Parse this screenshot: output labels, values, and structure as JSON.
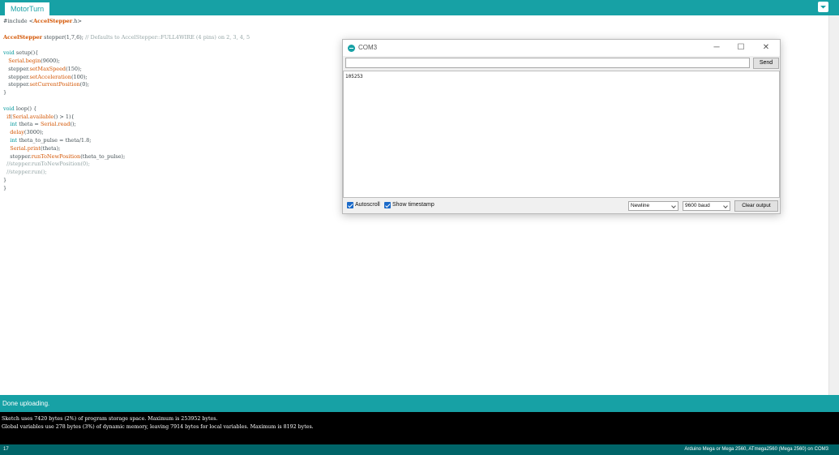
{
  "tabbar": {
    "active_tab": "MotorTurn"
  },
  "editor": {
    "lines": [
      [
        {
          "t": "#include <",
          "c": ""
        },
        {
          "t": "AccelStepper",
          "c": "cls"
        },
        {
          "t": ".h>",
          "c": ""
        }
      ],
      [],
      [
        {
          "t": "AccelStepper",
          "c": "cls"
        },
        {
          "t": " stepper(1,7,6); ",
          "c": ""
        },
        {
          "t": "// Defaults to AccelStepper::FULL4WIRE (4 pins) on 2, 3, 4, 5",
          "c": "cm"
        }
      ],
      [],
      [
        {
          "t": "void",
          "c": "ty"
        },
        {
          "t": " setup(){",
          "c": ""
        }
      ],
      [
        {
          "t": "   ",
          "c": ""
        },
        {
          "t": "Serial",
          "c": "kw"
        },
        {
          "t": ".",
          "c": ""
        },
        {
          "t": "begin",
          "c": "fn"
        },
        {
          "t": "(9600);",
          "c": ""
        }
      ],
      [
        {
          "t": "   stepper.",
          "c": ""
        },
        {
          "t": "setMaxSpeed",
          "c": "fn"
        },
        {
          "t": "(150);",
          "c": ""
        }
      ],
      [
        {
          "t": "   stepper.",
          "c": ""
        },
        {
          "t": "setAcceleration",
          "c": "fn"
        },
        {
          "t": "(100);",
          "c": ""
        }
      ],
      [
        {
          "t": "   stepper.",
          "c": ""
        },
        {
          "t": "setCurrentPosition",
          "c": "fn"
        },
        {
          "t": "(0);",
          "c": ""
        }
      ],
      [
        {
          "t": "}",
          "c": ""
        }
      ],
      [],
      [
        {
          "t": "void",
          "c": "ty"
        },
        {
          "t": " loop() {",
          "c": ""
        }
      ],
      [
        {
          "t": "  ",
          "c": ""
        },
        {
          "t": "if",
          "c": "kw"
        },
        {
          "t": "(",
          "c": ""
        },
        {
          "t": "Serial",
          "c": "kw"
        },
        {
          "t": ".",
          "c": ""
        },
        {
          "t": "available",
          "c": "fn"
        },
        {
          "t": "() > 1){",
          "c": ""
        }
      ],
      [
        {
          "t": "    ",
          "c": ""
        },
        {
          "t": "int",
          "c": "ty"
        },
        {
          "t": " theta = ",
          "c": ""
        },
        {
          "t": "Serial",
          "c": "kw"
        },
        {
          "t": ".",
          "c": ""
        },
        {
          "t": "read",
          "c": "fn"
        },
        {
          "t": "();",
          "c": ""
        }
      ],
      [
        {
          "t": "    ",
          "c": ""
        },
        {
          "t": "delay",
          "c": "fn"
        },
        {
          "t": "(3000);",
          "c": ""
        }
      ],
      [
        {
          "t": "    ",
          "c": ""
        },
        {
          "t": "int",
          "c": "ty"
        },
        {
          "t": " theta_to_pulse = theta/1.8;",
          "c": ""
        }
      ],
      [
        {
          "t": "    ",
          "c": ""
        },
        {
          "t": "Serial",
          "c": "kw"
        },
        {
          "t": ".",
          "c": ""
        },
        {
          "t": "print",
          "c": "fn"
        },
        {
          "t": "(theta);",
          "c": ""
        }
      ],
      [
        {
          "t": "    stepper.",
          "c": ""
        },
        {
          "t": "runToNewPosition",
          "c": "fn"
        },
        {
          "t": "(theta_to_pulse);",
          "c": ""
        }
      ],
      [
        {
          "t": "  //stepper.runToNewPosition(0);",
          "c": "cm"
        }
      ],
      [
        {
          "t": "  //stepper.run();",
          "c": "cm"
        }
      ],
      [
        {
          "t": "}",
          "c": ""
        }
      ],
      [
        {
          "t": "}",
          "c": ""
        }
      ]
    ]
  },
  "serial_monitor": {
    "title": "COM3",
    "input_value": "",
    "send_label": "Send",
    "output_text": "105253",
    "autoscroll_label": "Autoscroll",
    "autoscroll_checked": true,
    "timestamp_label": "Show timestamp",
    "timestamp_checked": true,
    "line_ending": "Newline",
    "baud": "9600 baud",
    "clear_label": "Clear output",
    "minimize_glyph": "─",
    "maximize_glyph": "☐",
    "close_glyph": "✕"
  },
  "status": {
    "message": "Done uploading."
  },
  "console": {
    "lines": [
      "Sketch uses 7420 bytes (2%) of program storage space. Maximum is 253952 bytes.",
      "Global variables use 278 bytes (3%) of dynamic memory, leaving 7914 bytes for local variables. Maximum is 8192 bytes."
    ]
  },
  "footer": {
    "line_number": "17",
    "board": "Arduino Mega or Mega 2560, ATmega2560 (Mega 2560) on COM3"
  },
  "colors": {
    "accent": "#17a1a5",
    "footer": "#006468",
    "console_bg": "#000000"
  }
}
